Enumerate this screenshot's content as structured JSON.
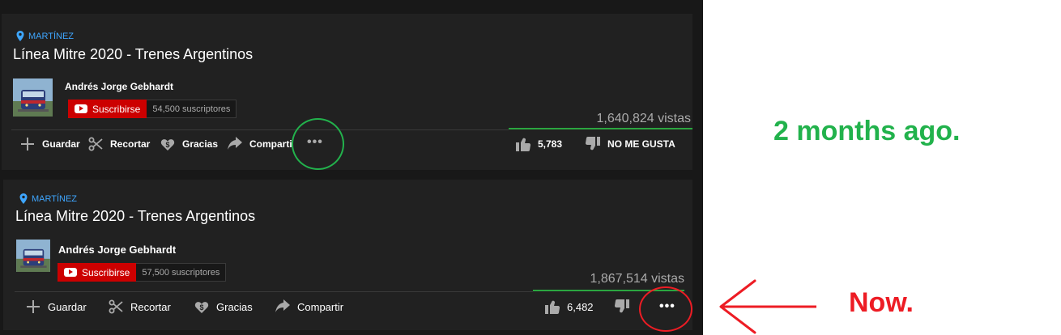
{
  "colors": {
    "page_bg": "#181818",
    "card_bg": "#212121",
    "location_blue": "#3ea6ff",
    "subscribe_red": "#cc0000",
    "sentiment_green": "#2ba640",
    "annotation_green": "#22b24c",
    "annotation_red": "#ed1c24"
  },
  "old_card": {
    "location": "MARTÍNEZ",
    "title": "Línea Mitre 2020 - Trenes Argentinos",
    "channel": "Andrés Jorge Gebhardt",
    "subscribe_label": "Suscribirse",
    "subscriber_count": "54,500 suscriptores",
    "views": "1,640,824 vistas",
    "actions": {
      "save": "Guardar",
      "clip": "Recortar",
      "thanks": "Gracias",
      "share": "Comparti"
    },
    "more": "•••",
    "likes": "5,783",
    "dislike_label": "NO ME GUSTA"
  },
  "new_card": {
    "location": "MARTÍNEZ",
    "title": "Línea Mitre 2020 - Trenes Argentinos",
    "channel": "Andrés Jorge Gebhardt",
    "subscribe_label": "Suscribirse",
    "subscriber_count": "57,500 suscriptores",
    "views": "1,867,514 vistas",
    "actions": {
      "save": "Guardar",
      "clip": "Recortar",
      "thanks": "Gracias",
      "share": "Compartir"
    },
    "likes": "6,482",
    "more": "•••"
  },
  "annotations": {
    "old": "2 months ago.",
    "new": "Now."
  },
  "icons": [
    "location-pin-icon",
    "youtube-icon",
    "plus-icon",
    "scissors-icon",
    "thanks-icon",
    "share-icon",
    "thumbs-up-icon",
    "thumbs-down-icon",
    "more-icon",
    "arrow-icon"
  ]
}
